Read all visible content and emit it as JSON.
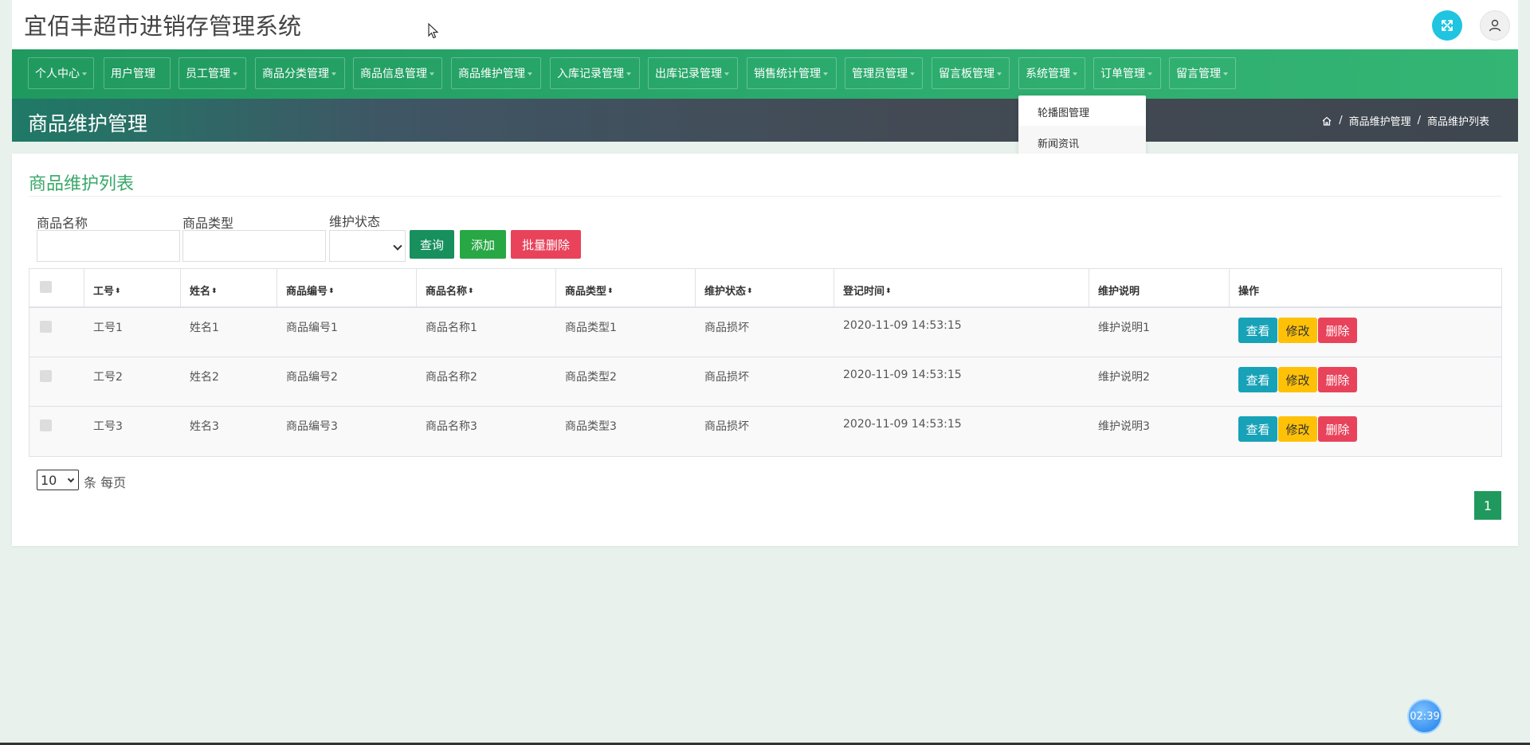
{
  "app": {
    "title": "宜佰丰超市进销存管理系统"
  },
  "nav": [
    {
      "label": "个人中心"
    },
    {
      "label": "用户管理"
    },
    {
      "label": "员工管理"
    },
    {
      "label": "商品分类管理"
    },
    {
      "label": "商品信息管理"
    },
    {
      "label": "商品维护管理"
    },
    {
      "label": "入库记录管理"
    },
    {
      "label": "出库记录管理"
    },
    {
      "label": "销售统计管理"
    },
    {
      "label": "管理员管理"
    },
    {
      "label": "留言板管理"
    },
    {
      "label": "系统管理"
    },
    {
      "label": "订单管理"
    },
    {
      "label": "留言管理"
    }
  ],
  "dropdown": {
    "items": [
      {
        "label": "轮播图管理"
      },
      {
        "label": "新闻资讯"
      }
    ]
  },
  "page": {
    "title": "商品维护管理",
    "breadcrumb": [
      "商品维护管理",
      "商品维护列表"
    ]
  },
  "card": {
    "title": "商品维护列表"
  },
  "filters": {
    "name_label": "商品名称",
    "type_label": "商品类型",
    "status_label": "维护状态",
    "name_value": "",
    "type_value": "",
    "status_value": "",
    "query_btn": "查询",
    "add_btn": "添加",
    "batch_delete_btn": "批量删除"
  },
  "table": {
    "headers": [
      "工号",
      "姓名",
      "商品编号",
      "商品名称",
      "商品类型",
      "维护状态",
      "登记时间",
      "维护说明",
      "操作"
    ],
    "rows": [
      [
        "工号1",
        "姓名1",
        "商品编号1",
        "商品名称1",
        "商品类型1",
        "商品损坏",
        "2020-11-09 14:53:15",
        "维护说明1"
      ],
      [
        "工号2",
        "姓名2",
        "商品编号2",
        "商品名称2",
        "商品类型2",
        "商品损坏",
        "2020-11-09 14:53:15",
        "维护说明2"
      ],
      [
        "工号3",
        "姓名3",
        "商品编号3",
        "商品名称3",
        "商品类型3",
        "商品损坏",
        "2020-11-09 14:53:15",
        "维护说明3"
      ]
    ],
    "actions": {
      "view": "查看",
      "edit": "修改",
      "delete": "删除"
    }
  },
  "pagination": {
    "page_size": "10",
    "page_size_suffix": "条 每页",
    "current_page": "1"
  },
  "timer": {
    "text": "02:39"
  },
  "colors": {
    "brand": "#20995e",
    "accent_title": "#39a86a",
    "view": "#17a2b8",
    "edit": "#ffc107",
    "delete": "#e8435b"
  }
}
